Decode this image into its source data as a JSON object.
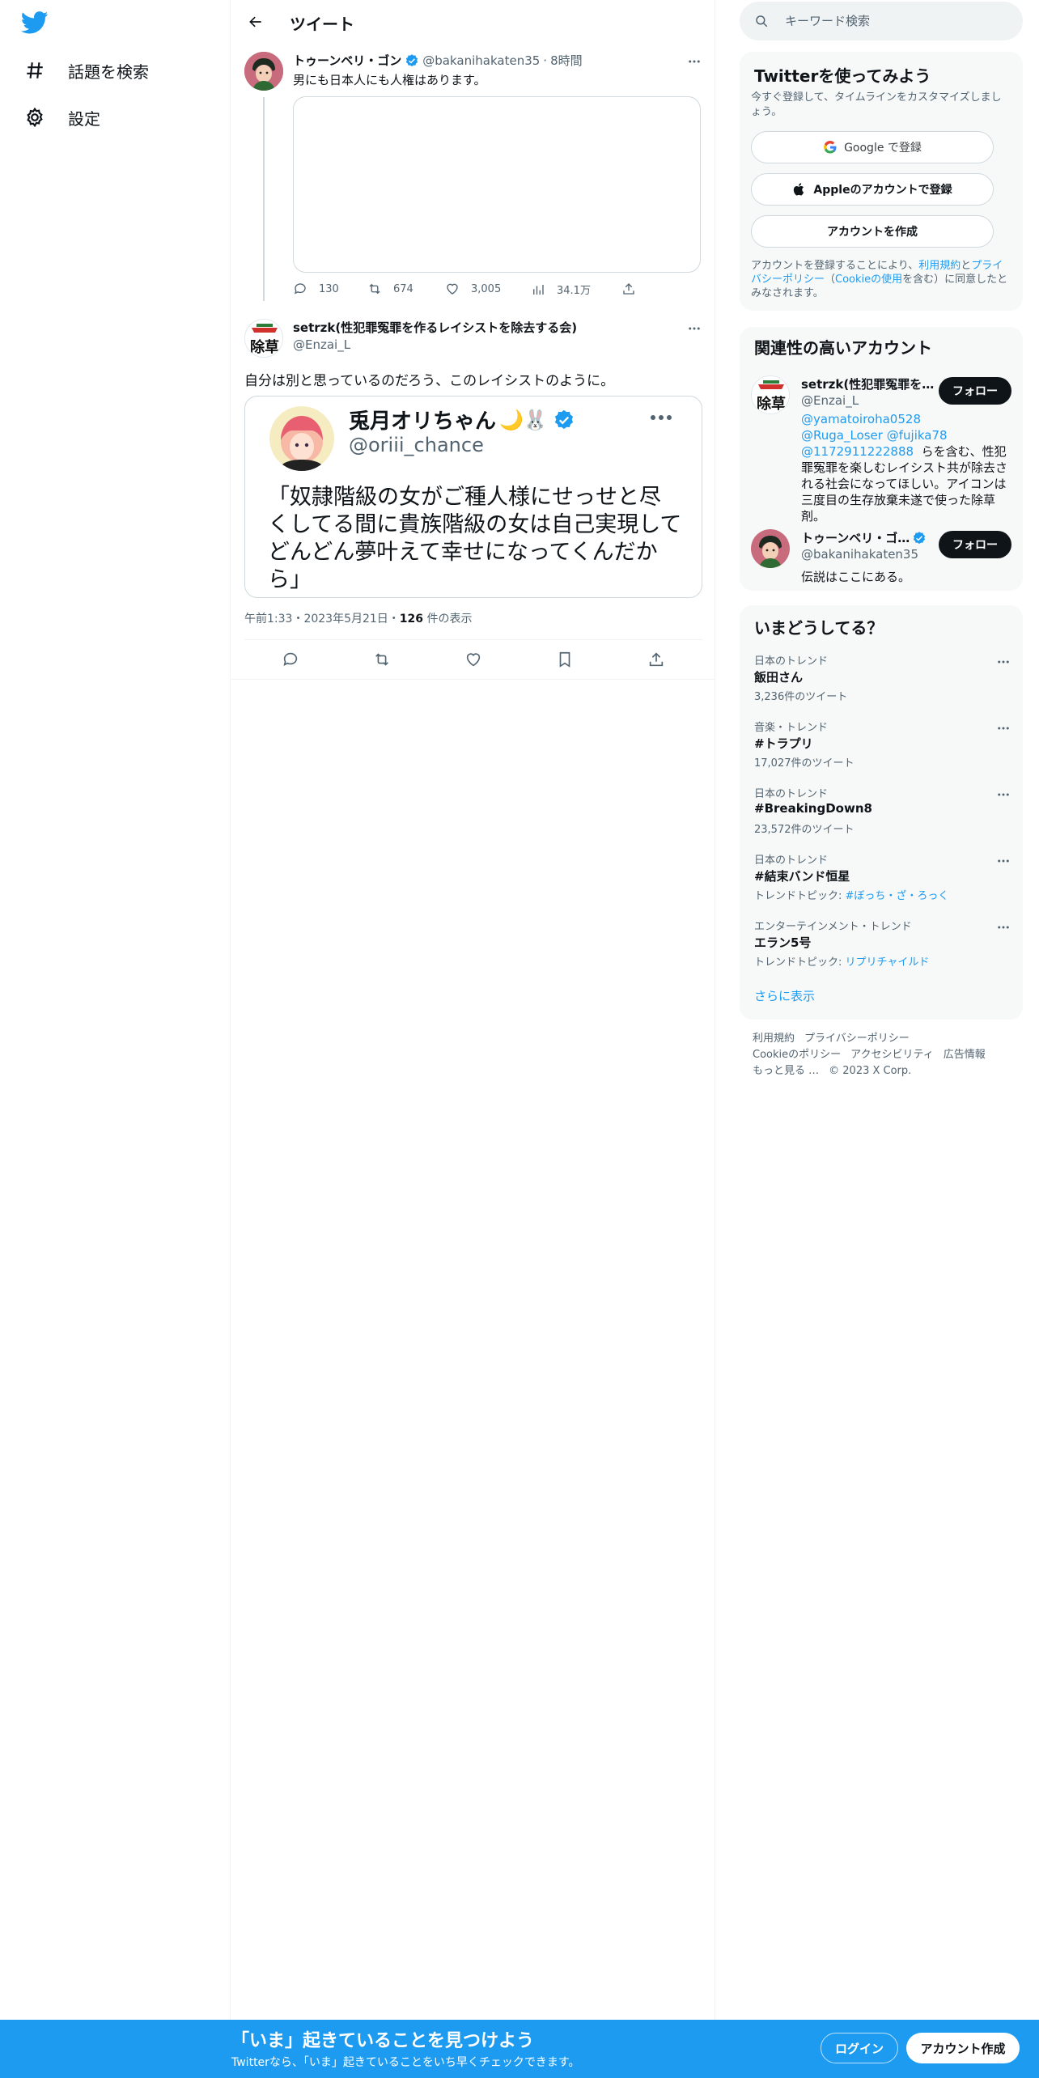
{
  "nav": {
    "explore_label": "話題を検索",
    "settings_label": "設定"
  },
  "header": {
    "title": "ツイート"
  },
  "parent_tweet": {
    "name": "トゥーンベリ・ゴン",
    "handle": "@bakanihakaten35",
    "time": "8時間",
    "text": "男にも日本人にも人権はあります。",
    "replies": "130",
    "retweets": "674",
    "likes": "3,005",
    "views": "34.1万"
  },
  "main_tweet": {
    "name": "setrzk(性犯罪冤罪を作るレイシストを除去する会)",
    "handle": "@Enzai_L",
    "avatar_text": "除草",
    "text": "自分は別と思っているのだろう、このレイシストのように。",
    "timestamp": "午前1:33・2023年5月21日・",
    "views_count": "126",
    "views_label": " 件の表示"
  },
  "embedded_image": {
    "name": "兎月オリちゃん",
    "name_emoji": "🌙🐰",
    "handle": "@oriii_chance",
    "text": "「奴隷階級の女がご種人様にせっせと尽くしてる間に貴族階級の女は自己実現してどんどん夢叶えて幸せになってくんだから」"
  },
  "search": {
    "placeholder": "キーワード検索"
  },
  "signup_box": {
    "title": "Twitterを使ってみよう",
    "subtitle": "今すぐ登録して、タイムラインをカスタマイズしましょう。",
    "google_label": "Google で登録",
    "apple_label": "Appleのアカウントで登録",
    "create_label": "アカウントを作成",
    "legal_prefix": "アカウントを登録することにより、",
    "legal_terms": "利用規約",
    "legal_and": "と",
    "legal_privacy": "プライバシーポリシー",
    "legal_open": "（",
    "legal_cookie": "Cookieの使用",
    "legal_suffix": "を含む）に同意したとみなされます。"
  },
  "related": {
    "title": "関連性の高いアカウント",
    "accounts": [
      {
        "name": "setrzk(性犯罪冤罪を…",
        "handle": "@Enzai_L",
        "follow": "フォロー",
        "bio_mentions": [
          "@yamatoiroha0528",
          "@Ruga_Loser",
          "@fujika78",
          "@1172911222888"
        ],
        "bio_text_1": "らを含む、性犯罪冤罪を楽しむレイシスト共が除去される社会になってほしい。",
        "bio_text_2": "アイコンは三度目の生存放棄未遂で使った除草剤。"
      },
      {
        "name": "トゥーンベリ・ゴ…",
        "handle": "@bakanihakaten35",
        "follow": "フォロー",
        "bio": "伝説はここにある。"
      }
    ]
  },
  "trends": {
    "title": "いまどうしてる？",
    "items": [
      {
        "category": "日本のトレンド",
        "name": "飯田さん",
        "sub": "3,236件のツイート"
      },
      {
        "category": "音楽・トレンド",
        "name": "#トラプリ",
        "sub": "17,027件のツイート"
      },
      {
        "category": "日本のトレンド",
        "name": "#BreakingDown8",
        "sub": "23,572件のツイート"
      },
      {
        "category": "日本のトレンド",
        "name": "#結束バンド恒星",
        "sub_prefix": "トレンドトピック: ",
        "sub_link": "#ぼっち・ざ・ろっく"
      },
      {
        "category": "エンターテインメント・トレンド",
        "name": "エラン5号",
        "sub_prefix": "トレンドトピック: ",
        "sub_link": "リプリチャイルド"
      }
    ],
    "show_more": "さらに表示"
  },
  "footer": {
    "links": [
      "利用規約",
      "プライバシーポリシー",
      "Cookieのポリシー",
      "アクセシビリティ",
      "広告情報",
      "もっと見る …"
    ],
    "copyright": "© 2023 X Corp."
  },
  "bottom_bar": {
    "title": "「いま」起きていることを見つけよう",
    "subtitle": "Twitterなら、「いま」起きていることをいち早くチェックできます。",
    "login": "ログイン",
    "signup": "アカウント作成"
  },
  "colors": {
    "accent": "#1d9bf0",
    "text": "#0f1419",
    "secondary": "#536471",
    "panel": "#f7f9f9",
    "border": "#eff3f4"
  }
}
